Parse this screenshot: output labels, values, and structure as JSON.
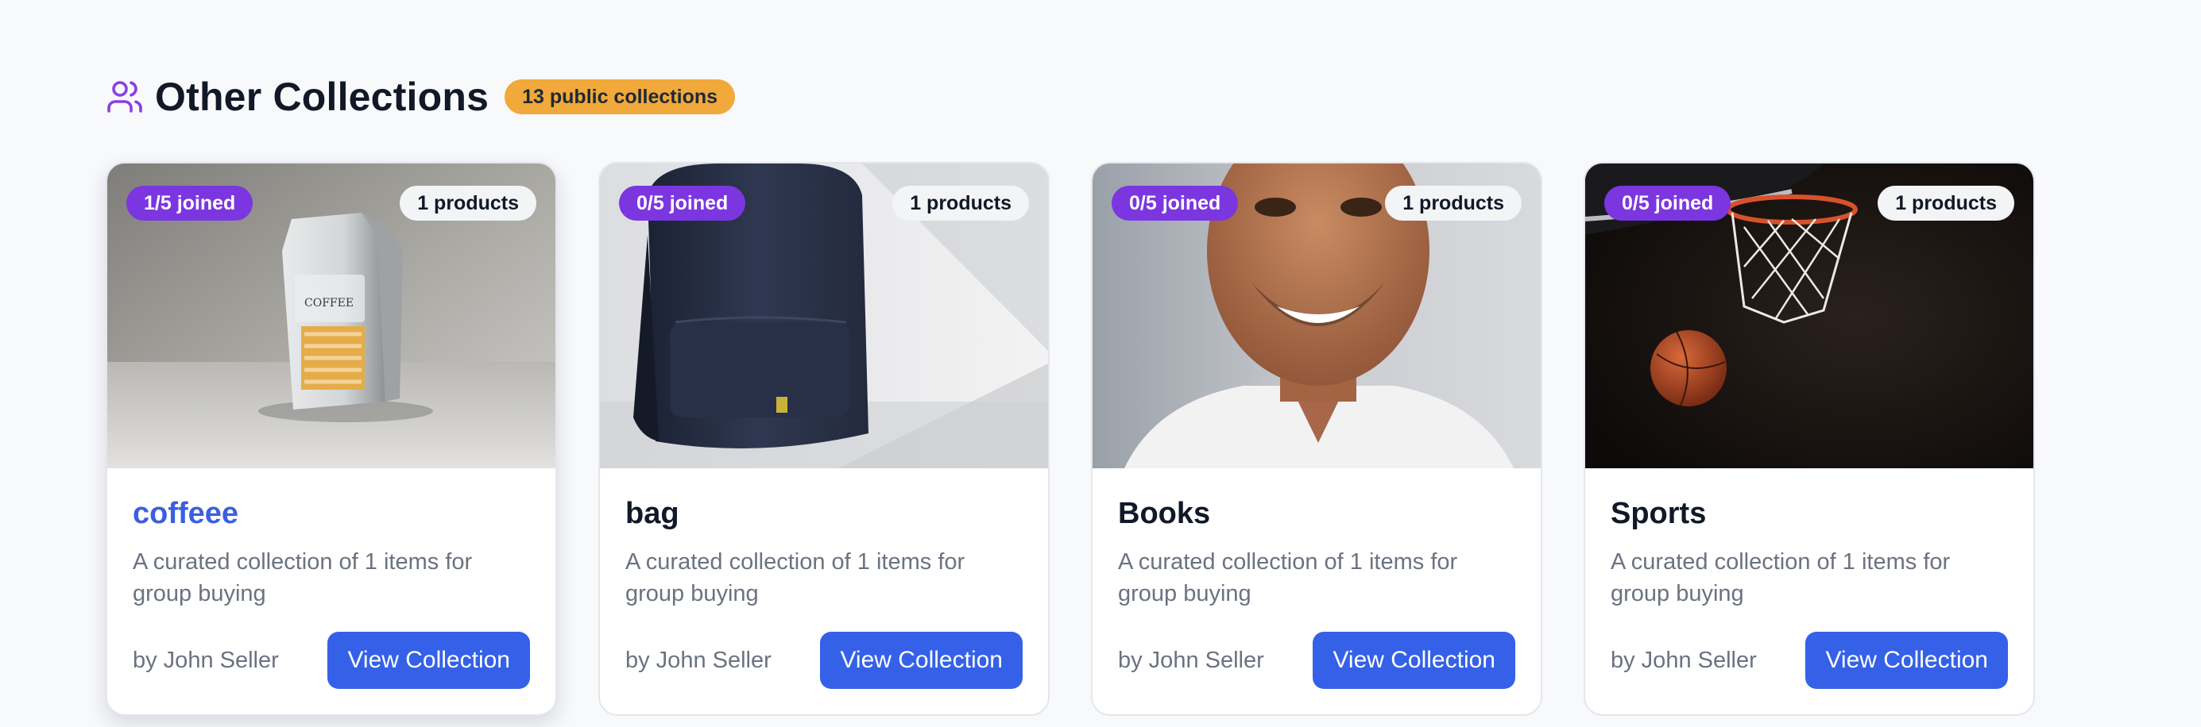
{
  "section": {
    "title": "Other Collections",
    "icon": "users-icon",
    "count_badge": "13 public collections"
  },
  "colors": {
    "accent_purple": "#7c36e0",
    "badge_orange": "#f0a93a",
    "button_blue": "#3461e8",
    "active_title_blue": "#3b5fe0"
  },
  "collections": [
    {
      "name": "coffeee",
      "joined": "1/5 joined",
      "products": "1 products",
      "description": "A curated collection of 1 items for group buying",
      "seller": "by John Seller",
      "button": "View Collection",
      "image": "coffee-bag-photo",
      "hovered": true
    },
    {
      "name": "bag",
      "joined": "0/5 joined",
      "products": "1 products",
      "description": "A curated collection of 1 items for group buying",
      "seller": "by John Seller",
      "button": "View Collection",
      "image": "backpack-photo",
      "hovered": false
    },
    {
      "name": "Books",
      "joined": "0/5 joined",
      "products": "1 products",
      "description": "A curated collection of 1 items for group buying",
      "seller": "by John Seller",
      "button": "View Collection",
      "image": "smiling-man-photo",
      "hovered": false
    },
    {
      "name": "Sports",
      "joined": "0/5 joined",
      "products": "1 products",
      "description": "A curated collection of 1 items for group buying",
      "seller": "by John Seller",
      "button": "View Collection",
      "image": "basketball-hoop-photo",
      "hovered": false
    }
  ]
}
